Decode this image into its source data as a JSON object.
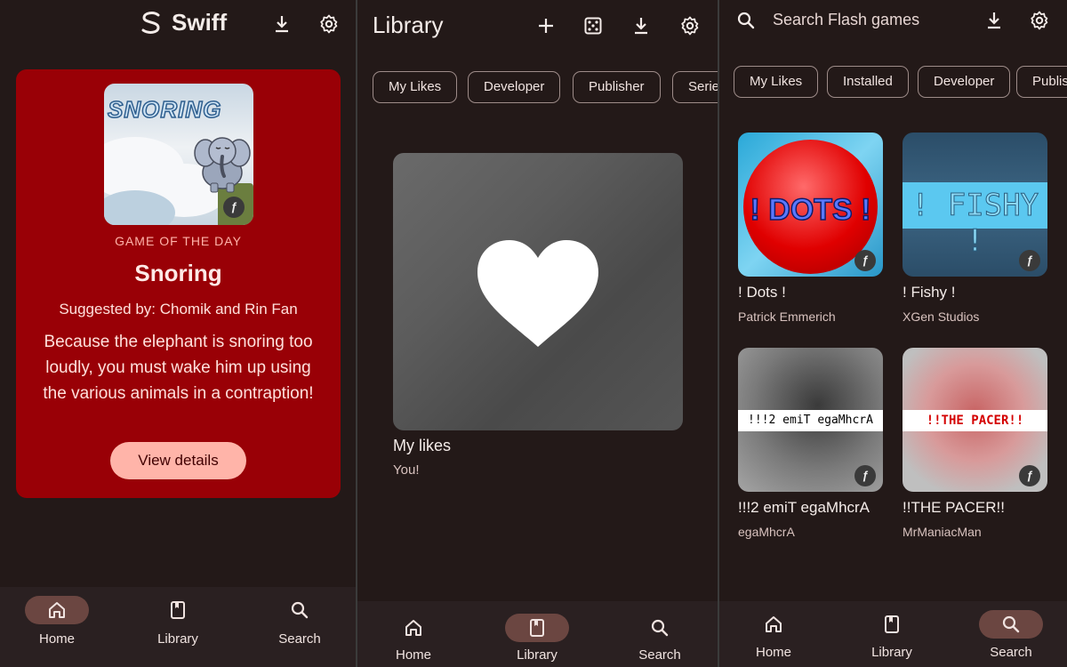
{
  "colors": {
    "background": "#231918",
    "card": "#990006",
    "accent_button": "#ffb4a9",
    "nav_active": "#6b4641",
    "chip_border": "#9e8c89"
  },
  "home_screen": {
    "app_name": "Swiff",
    "logo_icon": "swiff-logo-icon",
    "toolbar_icons": [
      "download-icon",
      "gear-icon"
    ],
    "game_of_the_day": {
      "thumbnail_word": "SNORING",
      "label": "GAME OF THE DAY",
      "title": "Snoring",
      "suggested_by": "Suggested by: Chomik and Rin Fan",
      "description": "Because the elephant is snoring too loudly, you must wake him up using the various animals in a contraption!",
      "button_label": "View details"
    },
    "nav": [
      {
        "label": "Home",
        "icon": "home-icon",
        "active": true
      },
      {
        "label": "Library",
        "icon": "book-icon",
        "active": false
      },
      {
        "label": "Search",
        "icon": "search-icon",
        "active": false
      }
    ]
  },
  "library_screen": {
    "title": "Library",
    "toolbar_icons": [
      "add-icon",
      "dice-icon",
      "download-icon",
      "gear-icon"
    ],
    "chips": [
      "My Likes",
      "Developer",
      "Publisher",
      "Series"
    ],
    "playlist": {
      "title": "My likes",
      "subtitle": "You!",
      "icon": "heart-icon"
    },
    "nav": [
      {
        "label": "Home",
        "icon": "home-icon",
        "active": false
      },
      {
        "label": "Library",
        "icon": "book-icon",
        "active": true
      },
      {
        "label": "Search",
        "icon": "search-icon",
        "active": false
      }
    ]
  },
  "search_screen": {
    "search_placeholder": "Search Flash games",
    "toolbar_icons": [
      "search-icon",
      "download-icon",
      "gear-icon"
    ],
    "chips": [
      "My Likes",
      "Installed",
      "Developer",
      "Publisher"
    ],
    "games": [
      {
        "title": "! Dots !",
        "developer": "Patrick Emmerich",
        "thumbnail_text": "! DOTS !"
      },
      {
        "title": "! Fishy !",
        "developer": "XGen Studios",
        "thumbnail_text": "! FISHY !"
      },
      {
        "title": "!!!2 emiT egaMhcrA",
        "developer": "egaMhcrA",
        "thumbnail_text": "!!!2 emiT egaMhcrA"
      },
      {
        "title": "!!THE PACER!!",
        "developer": "MrManiacMan",
        "thumbnail_text": "!!THE PACER!!"
      }
    ],
    "nav": [
      {
        "label": "Home",
        "icon": "home-icon",
        "active": false
      },
      {
        "label": "Library",
        "icon": "book-icon",
        "active": false
      },
      {
        "label": "Search",
        "icon": "search-icon",
        "active": true
      }
    ]
  }
}
